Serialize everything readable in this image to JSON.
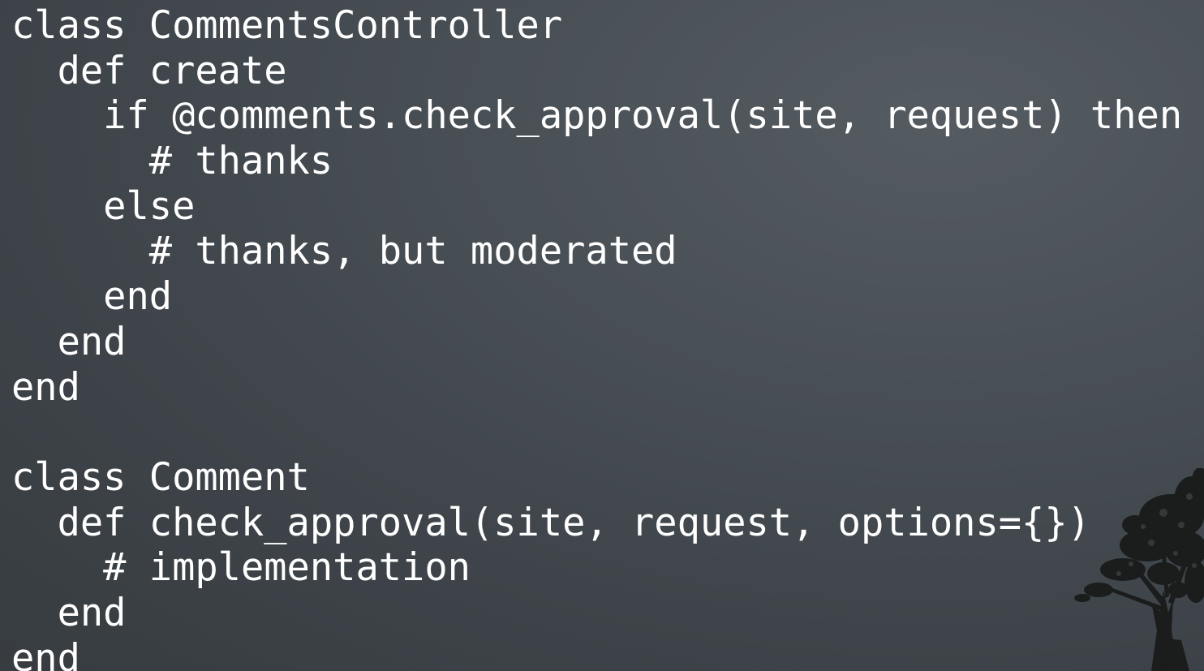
{
  "slide": {
    "background_color": "#41474c",
    "text_color": "#ffffff",
    "decoration": "tree-silhouette"
  },
  "code": {
    "language": "ruby",
    "lines": [
      "class CommentsController",
      "  def create",
      "    if @comments.check_approval(site, request) then",
      "      # thanks",
      "    else",
      "      # thanks, but moderated",
      "    end",
      "  end",
      "end",
      "",
      "class Comment",
      "  def check_approval(site, request, options={})",
      "    # implementation",
      "  end",
      "end"
    ]
  }
}
